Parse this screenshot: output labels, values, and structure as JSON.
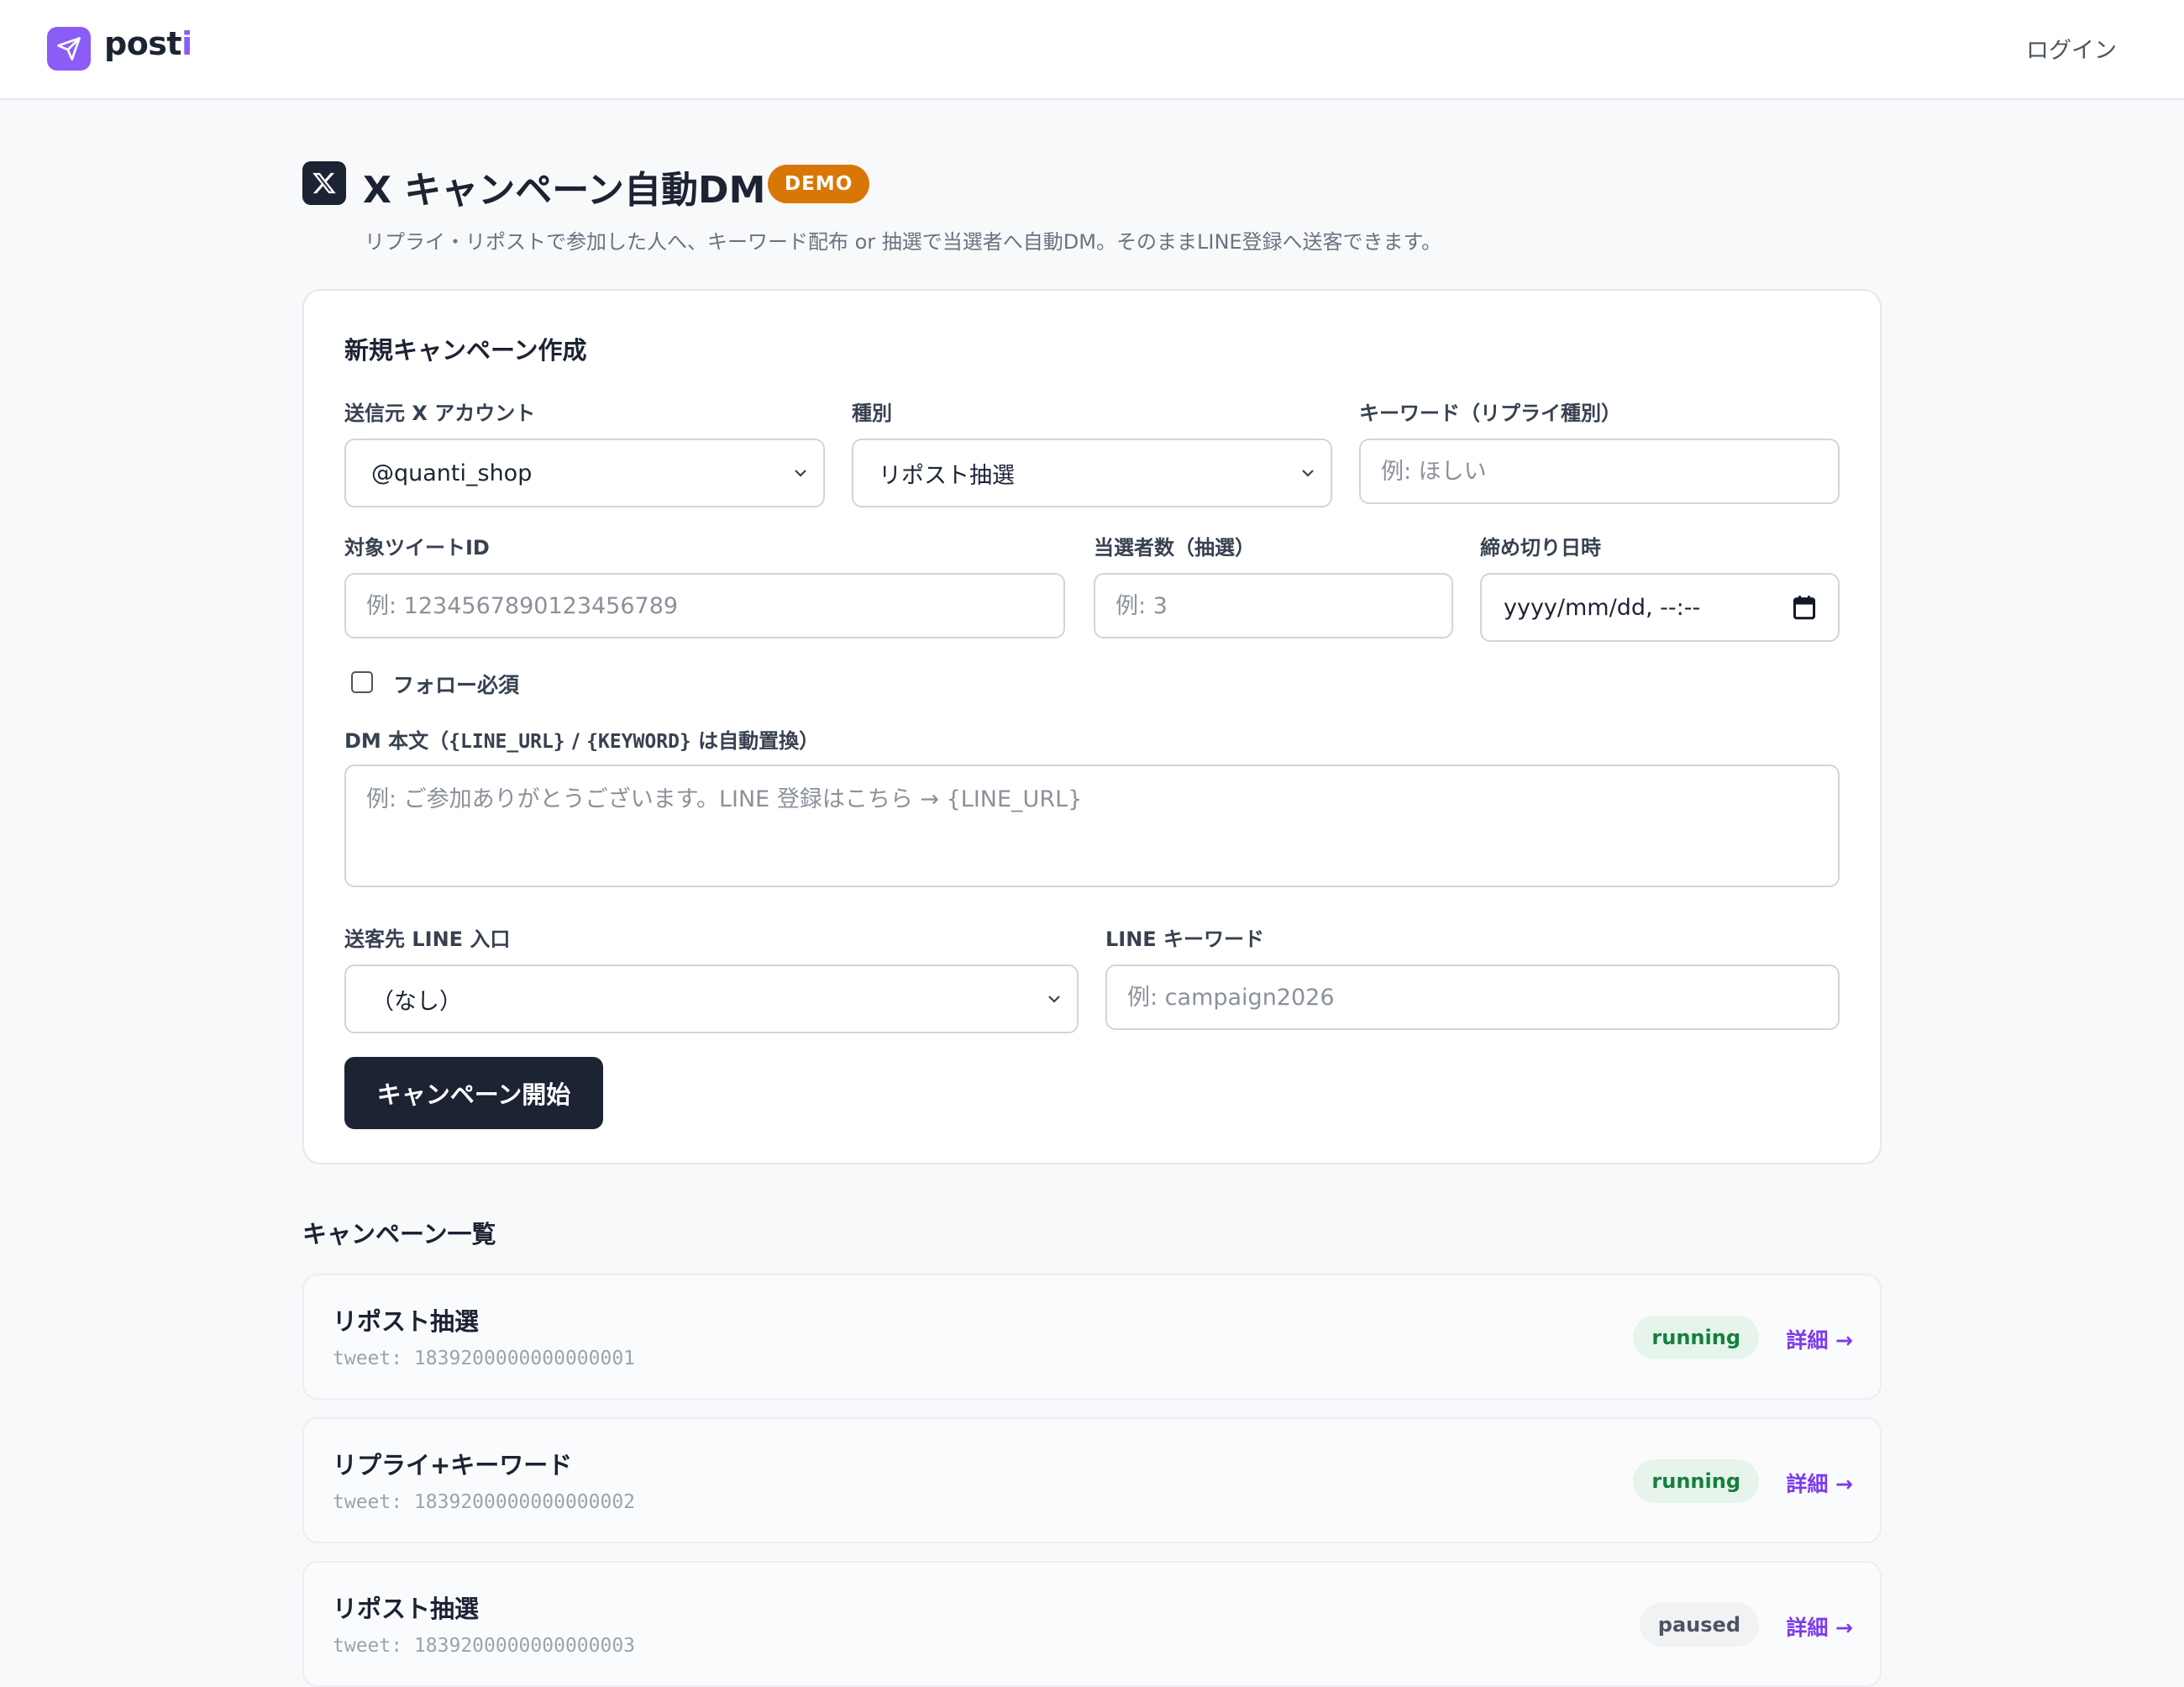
{
  "header": {
    "logo_text_main": "post",
    "logo_text_accent": "i",
    "login_label": "ログイン"
  },
  "page": {
    "title": "X キャンペーン自動DM",
    "badge": "DEMO",
    "subtitle": "リプライ・リポストで参加した人へ、キーワード配布 or 抽選で当選者へ自動DM。そのままLINE登録へ送客できます。"
  },
  "form": {
    "title": "新規キャンペーン作成",
    "sender_label": "送信元 X アカウント",
    "sender_value": "@quanti_shop",
    "type_label": "種別",
    "type_value": "リポスト抽選",
    "keyword_label": "キーワード（リプライ種別）",
    "keyword_placeholder": "例: ほしい",
    "tweet_label": "対象ツイートID",
    "tweet_placeholder": "例: 1234567890123456789",
    "winners_label": "当選者数（抽選）",
    "winners_placeholder": "例: 3",
    "deadline_label": "締め切り日時",
    "deadline_value": "yyyy/mm/dd, --:--",
    "follow_label": "フォロー必須",
    "dm_label_prefix": "DM 本文（",
    "dm_label_token1": "{LINE_URL}",
    "dm_label_sep": " / ",
    "dm_label_token2": "{KEYWORD}",
    "dm_label_suffix": " は自動置換）",
    "dm_placeholder": "例: ご参加ありがとうございます。LINE 登録はこちら → {LINE_URL}",
    "line_entry_label": "送客先 LINE 入口",
    "line_entry_value": "（なし）",
    "line_keyword_label": "LINE キーワード",
    "line_keyword_placeholder": "例: campaign2026",
    "submit_label": "キャンペーン開始"
  },
  "list": {
    "heading": "キャンペーン一覧",
    "detail_label": "詳細 →",
    "items": [
      {
        "title": "リポスト抽選",
        "tweet": "tweet: 1839200000000000001",
        "status": "running"
      },
      {
        "title": "リプライ+キーワード",
        "tweet": "tweet: 1839200000000000002",
        "status": "running"
      },
      {
        "title": "リポスト抽選",
        "tweet": "tweet: 1839200000000000003",
        "status": "paused"
      }
    ]
  },
  "colors": {
    "brand": "#8b5cf6",
    "navy": "#1c2333",
    "demo": "#d97706",
    "running": "#15803d",
    "link": "#7c3aed"
  }
}
